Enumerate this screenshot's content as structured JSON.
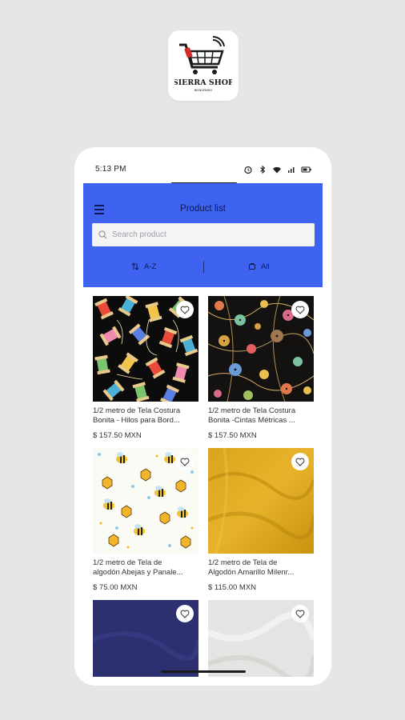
{
  "logo": {
    "brand_text": "SIERRA SHOP",
    "tagline": "BIENVENIDO"
  },
  "status_bar": {
    "time": "5:13 PM"
  },
  "app_bar": {
    "title": "Product list",
    "search_placeholder": "Search product",
    "sort_label": "A-Z",
    "filter_label": "All"
  },
  "products": [
    {
      "name_line1": "1/2 metro de Tela Costura",
      "name_line2": "Bonita - Hilos para Bord...",
      "price": "$ 157.50 MXN",
      "pattern": "thread spools on black"
    },
    {
      "name_line1": "1/2 metro de Tela Costura",
      "name_line2": "Bonita -Cintas Métricas ...",
      "price": "$ 157.50 MXN",
      "pattern": "buttons and measuring tapes on black"
    },
    {
      "name_line1": "1/2 metro de Tela de",
      "name_line2": "algodón Abejas y Panale...",
      "price": "$ 75.00 MXN",
      "pattern": "bees and honeycombs on white"
    },
    {
      "name_line1": "1/2 metro de Tela de",
      "name_line2": "Algodón Amarillo Milenr...",
      "price": "$ 115.00 MXN",
      "pattern": "solid mustard yellow"
    },
    {
      "name_line1": "",
      "name_line2": "",
      "price": "",
      "pattern": "solid navy blue"
    },
    {
      "name_line1": "",
      "name_line2": "",
      "price": "",
      "pattern": "solid light grey"
    }
  ],
  "colors": {
    "app_bar": "#3d63f0",
    "page_background": "#e6e6e6",
    "text": "#333333"
  }
}
